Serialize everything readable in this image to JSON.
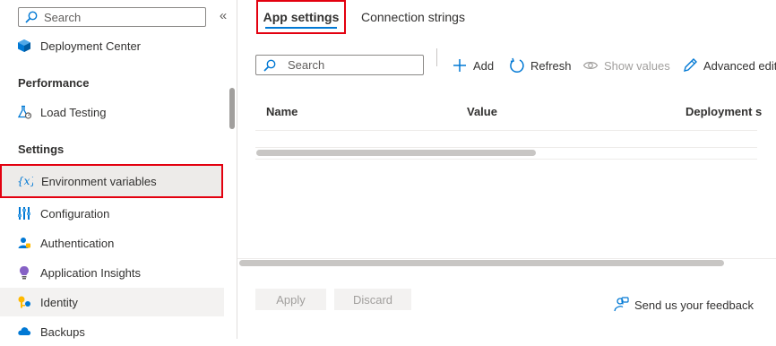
{
  "sidebar": {
    "search_placeholder": "Search",
    "collapse_glyph": "«",
    "items_top": [
      {
        "label": "Deployment Center",
        "icon": "deployment-center-icon"
      }
    ],
    "sections": [
      {
        "title": "Performance",
        "items": [
          {
            "label": "Load Testing",
            "icon": "load-testing-icon"
          }
        ]
      },
      {
        "title": "Settings",
        "items": [
          {
            "label": "Environment variables",
            "icon": "environment-variables-icon",
            "selected": true
          },
          {
            "label": "Configuration",
            "icon": "configuration-icon"
          },
          {
            "label": "Authentication",
            "icon": "authentication-icon"
          },
          {
            "label": "Application Insights",
            "icon": "application-insights-icon"
          },
          {
            "label": "Identity",
            "icon": "identity-icon"
          },
          {
            "label": "Backups",
            "icon": "backups-icon"
          }
        ]
      }
    ]
  },
  "tabs": [
    {
      "label": "App settings",
      "active": true
    },
    {
      "label": "Connection strings",
      "active": false
    }
  ],
  "toolbar": {
    "search_placeholder": "Search",
    "add_label": "Add",
    "refresh_label": "Refresh",
    "show_values_label": "Show values",
    "advanced_edit_label": "Advanced edit"
  },
  "table": {
    "columns": [
      "Name",
      "Value",
      "Deployment s"
    ]
  },
  "footer": {
    "apply_label": "Apply",
    "discard_label": "Discard",
    "feedback_label": "Send us your feedback"
  },
  "colors": {
    "accent": "#0078d4",
    "highlight_box": "#e3000f"
  }
}
